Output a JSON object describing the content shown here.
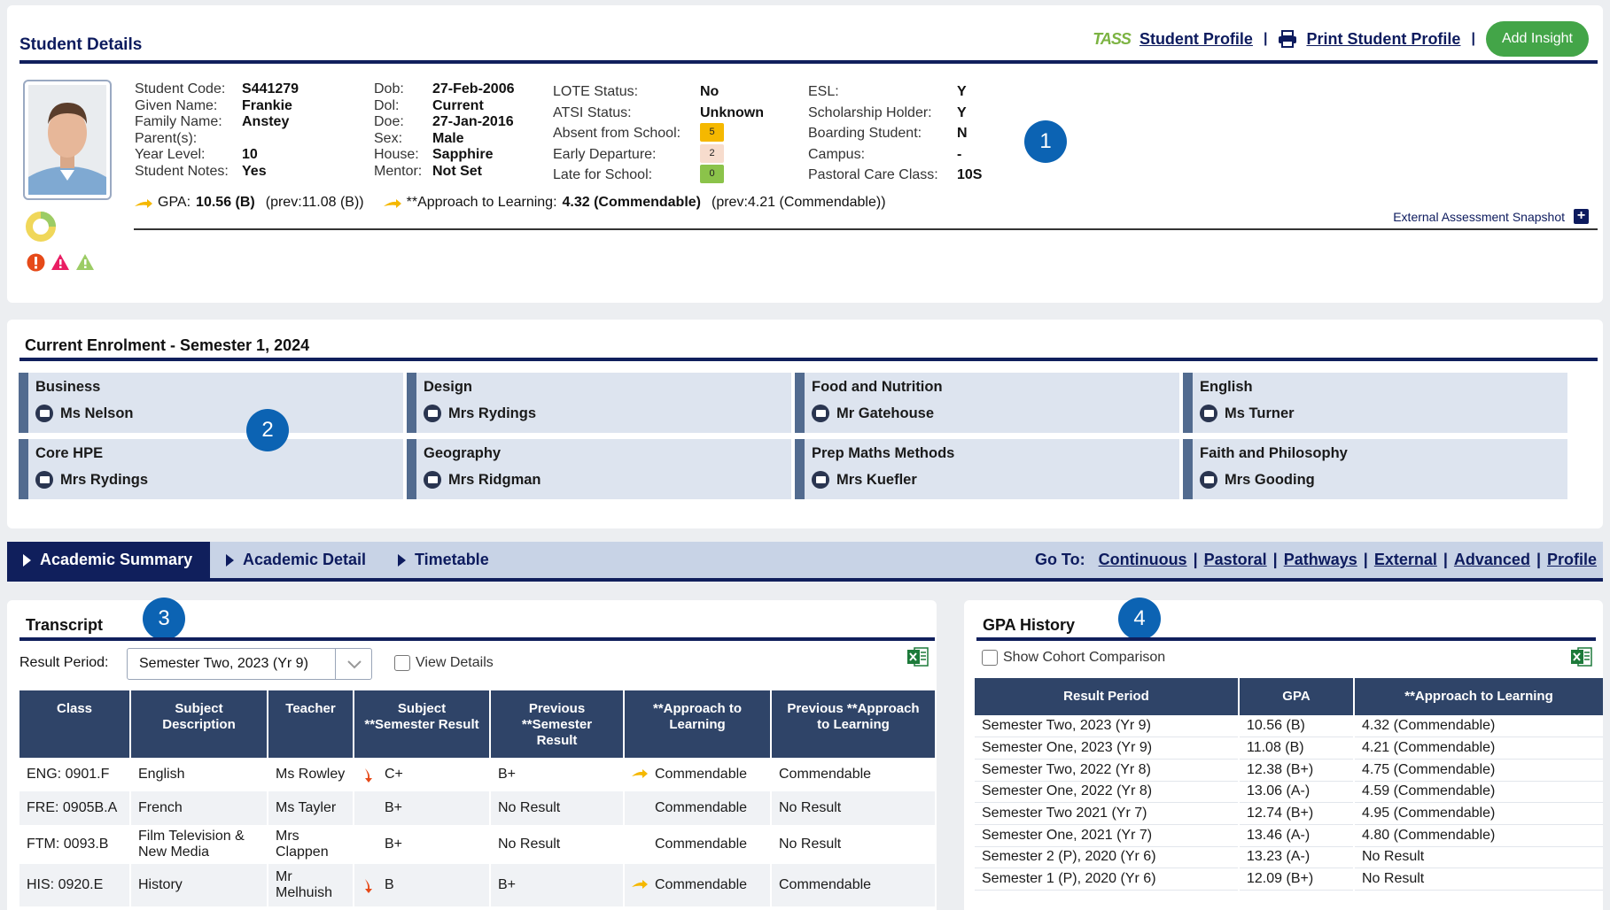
{
  "student_details": {
    "title": "Student Details",
    "tass_logo": "TASS",
    "student_profile_link": "Student Profile",
    "print_profile_link": "Print Student Profile",
    "add_insight_button": "Add Insight",
    "col1": [
      {
        "k": "Student Code:",
        "v": "S441279"
      },
      {
        "k": "Given Name:",
        "v": "Frankie"
      },
      {
        "k": "Family Name:",
        "v": "Anstey"
      },
      {
        "k": "Parent(s):",
        "v": ""
      },
      {
        "k": "Year Level:",
        "v": "10"
      },
      {
        "k": "Student Notes:",
        "v": "Yes"
      }
    ],
    "col2": [
      {
        "k": "Dob:",
        "v": "27-Feb-2006"
      },
      {
        "k": "Dol:",
        "v": "Current"
      },
      {
        "k": "Doe:",
        "v": "27-Jan-2016"
      },
      {
        "k": "Sex:",
        "v": "Male"
      },
      {
        "k": "House:",
        "v": "Sapphire"
      },
      {
        "k": "Mentor:",
        "v": "Not Set"
      }
    ],
    "col3": [
      {
        "k": "LOTE Status:",
        "v": "No"
      },
      {
        "k": "ATSI Status:",
        "v": "Unknown"
      },
      {
        "k": "Absent from School:",
        "v": "5",
        "color": "#f5b800"
      },
      {
        "k": "Early Departure:",
        "v": "2",
        "color": "#f7dccd"
      },
      {
        "k": "Late for School:",
        "v": "0",
        "color": "#8bc34a"
      }
    ],
    "col4": [
      {
        "k": "ESL:",
        "v": "Y"
      },
      {
        "k": "Scholarship Holder:",
        "v": "Y"
      },
      {
        "k": "Boarding Student:",
        "v": "N"
      },
      {
        "k": "Campus:",
        "v": "-"
      },
      {
        "k": "Pastoral Care Class:",
        "v": "10S"
      }
    ],
    "gpa_label": "GPA:",
    "gpa_value": "10.56 (B)",
    "gpa_prev": "(prev:11.08 (B))",
    "atl_label": "**Approach to Learning:",
    "atl_value": "4.32 (Commendable)",
    "atl_prev": "(prev:4.21 (Commendable))",
    "external_snapshot": "External Assessment Snapshot",
    "callout": "1"
  },
  "enrolment": {
    "title": "Current Enrolment - Semester 1, 2024",
    "callout": "2",
    "subjects": [
      {
        "subject": "Business",
        "teacher": "Ms Nelson"
      },
      {
        "subject": "Design",
        "teacher": "Mrs Rydings"
      },
      {
        "subject": "Food and Nutrition",
        "teacher": "Mr Gatehouse"
      },
      {
        "subject": "English",
        "teacher": "Ms Turner"
      },
      {
        "subject": "Core HPE",
        "teacher": "Mrs Rydings"
      },
      {
        "subject": "Geography",
        "teacher": "Mrs Ridgman"
      },
      {
        "subject": "Prep Maths Methods",
        "teacher": "Mrs Kuefler"
      },
      {
        "subject": "Faith and Philosophy",
        "teacher": "Mrs Gooding"
      }
    ]
  },
  "tabs": {
    "items": [
      "Academic Summary",
      "Academic Detail",
      "Timetable"
    ],
    "goto_label": "Go To:",
    "goto_links": [
      "Continuous",
      "Pastoral",
      "Pathways",
      "External",
      "Advanced",
      "Profile"
    ]
  },
  "transcript": {
    "title": "Transcript",
    "callout": "3",
    "result_period_label": "Result Period:",
    "result_period_value": "Semester Two, 2023 (Yr 9)",
    "view_details_label": "View Details",
    "headers": [
      "Class",
      "Subject Description",
      "Teacher",
      "Subject **Semester Result",
      "Previous **Semester Result",
      "**Approach to Learning",
      "Previous **Approach to Learning"
    ],
    "rows": [
      {
        "class": "ENG: 0901.F",
        "desc": "English",
        "teacher": "Ms Rowley",
        "result": "C+",
        "trend": "down",
        "prev": "B+",
        "atl": "Commendable",
        "atl_trend": "side",
        "prev_atl": "Commendable"
      },
      {
        "class": "FRE: 0905B.A",
        "desc": "French",
        "teacher": "Ms Tayler",
        "result": "B+",
        "trend": "",
        "prev": "No Result",
        "atl": "Commendable",
        "atl_trend": "",
        "prev_atl": "No Result"
      },
      {
        "class": "FTM: 0093.B",
        "desc": "Film Television & New Media",
        "teacher": "Mrs Clappen",
        "result": "B+",
        "trend": "",
        "prev": "No Result",
        "atl": "Commendable",
        "atl_trend": "",
        "prev_atl": "No Result"
      },
      {
        "class": "HIS: 0920.E",
        "desc": "History",
        "teacher": "Mr Melhuish",
        "result": "B",
        "trend": "down",
        "prev": "B+",
        "atl": "Commendable",
        "atl_trend": "side",
        "prev_atl": "Commendable"
      }
    ]
  },
  "gpa_history": {
    "title": "GPA History",
    "callout": "4",
    "cohort_label": "Show Cohort Comparison",
    "headers": [
      "Result Period",
      "GPA",
      "**Approach to Learning"
    ],
    "rows": [
      [
        "Semester Two, 2023 (Yr 9)",
        "10.56 (B)",
        "4.32 (Commendable)"
      ],
      [
        "Semester One, 2023 (Yr 9)",
        "11.08 (B)",
        "4.21 (Commendable)"
      ],
      [
        "Semester Two, 2022 (Yr 8)",
        "12.38 (B+)",
        "4.75 (Commendable)"
      ],
      [
        "Semester One, 2022 (Yr 8)",
        "13.06 (A-)",
        "4.59 (Commendable)"
      ],
      [
        "Semester Two 2021 (Yr 7)",
        "12.74 (B+)",
        "4.95 (Commendable)"
      ],
      [
        "Semester One, 2021 (Yr 7)",
        "13.46 (A-)",
        "4.80 (Commendable)"
      ],
      [
        "Semester 2 (P), 2020 (Yr 6)",
        "13.23 (A-)",
        "No Result"
      ],
      [
        "Semester 1 (P), 2020 (Yr 6)",
        "12.09 (B+)",
        "No Result"
      ]
    ]
  }
}
